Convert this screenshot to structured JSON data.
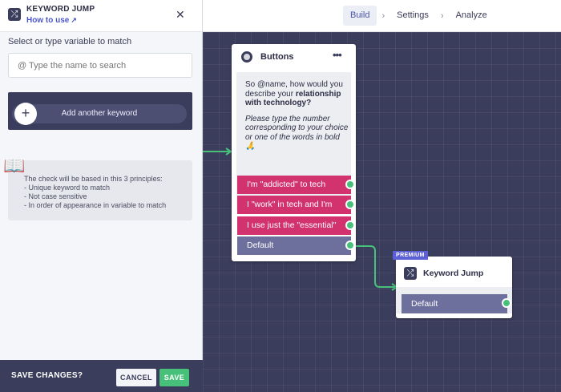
{
  "panel": {
    "title": "KEYWORD JUMP",
    "how_to_use": "How to use",
    "select_label": "Select or type variable to match",
    "search_placeholder": "@ Type the name to search",
    "add_keyword": "Add another keyword",
    "info_lines": [
      "The check will be based in this 3 principles:",
      "- Unique keyword to match",
      "- Not case sensitive",
      "- In order of appearance in variable to match"
    ],
    "save_changes": "SAVE CHANGES?",
    "cancel": "CANCEL",
    "save": "SAVE"
  },
  "nav": {
    "tabs": [
      "Build",
      "Settings",
      "Analyze"
    ],
    "separator": "›",
    "active": "Build"
  },
  "buttons_node": {
    "title": "Buttons",
    "menu": "•••",
    "message_intro": "So @name, how would you describe your",
    "message_bold": "relationship with technology?",
    "message_italic": "Please type the number corresponding to your choice or one of the words in bold 🙏",
    "options": [
      "I'm \"addicted\" to tech",
      "I \"work\" in tech and I'm",
      "I use just the \"essential\"",
      "Default"
    ]
  },
  "keyword_node": {
    "badge": "PREMIUM",
    "title": "Keyword Jump",
    "default": "Default"
  },
  "colors": {
    "canvas": "#3b3d5c",
    "option": "#d2336f",
    "default": "#6d6f9c",
    "connector": "#47c07a",
    "link": "#4a55c8",
    "premium": "#5c5fd6"
  }
}
